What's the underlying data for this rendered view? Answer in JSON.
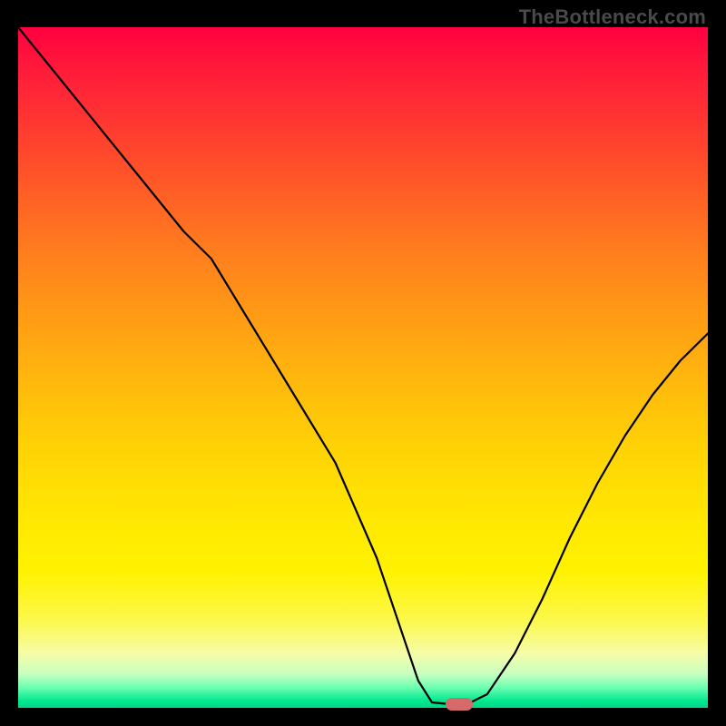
{
  "watermark": "TheBottleneck.com",
  "colors": {
    "frame": "#000000",
    "curve": "#000000",
    "marker": "#d46a6a",
    "gradient_top": "#ff0040",
    "gradient_bottom": "#00d685"
  },
  "chart_data": {
    "type": "line",
    "title": "",
    "xlabel": "",
    "ylabel": "",
    "xlim": [
      0,
      100
    ],
    "ylim": [
      0,
      100
    ],
    "annotations": [
      "TheBottleneck.com"
    ],
    "series": [
      {
        "name": "bottleneck-curve",
        "x": [
          0,
          8,
          16,
          24,
          28,
          34,
          40,
          46,
          52,
          56,
          58,
          60,
          63,
          65,
          68,
          72,
          76,
          80,
          84,
          88,
          92,
          96,
          100
        ],
        "y": [
          100,
          90,
          80,
          70,
          66,
          56,
          46,
          36,
          22,
          10,
          4,
          0.8,
          0.5,
          0.5,
          2,
          8,
          16,
          25,
          33,
          40,
          46,
          51,
          55
        ]
      }
    ],
    "marker": {
      "x": 64,
      "y": 0.5,
      "shape": "pill"
    },
    "background": "vertical-gradient red-orange-yellow-green"
  }
}
